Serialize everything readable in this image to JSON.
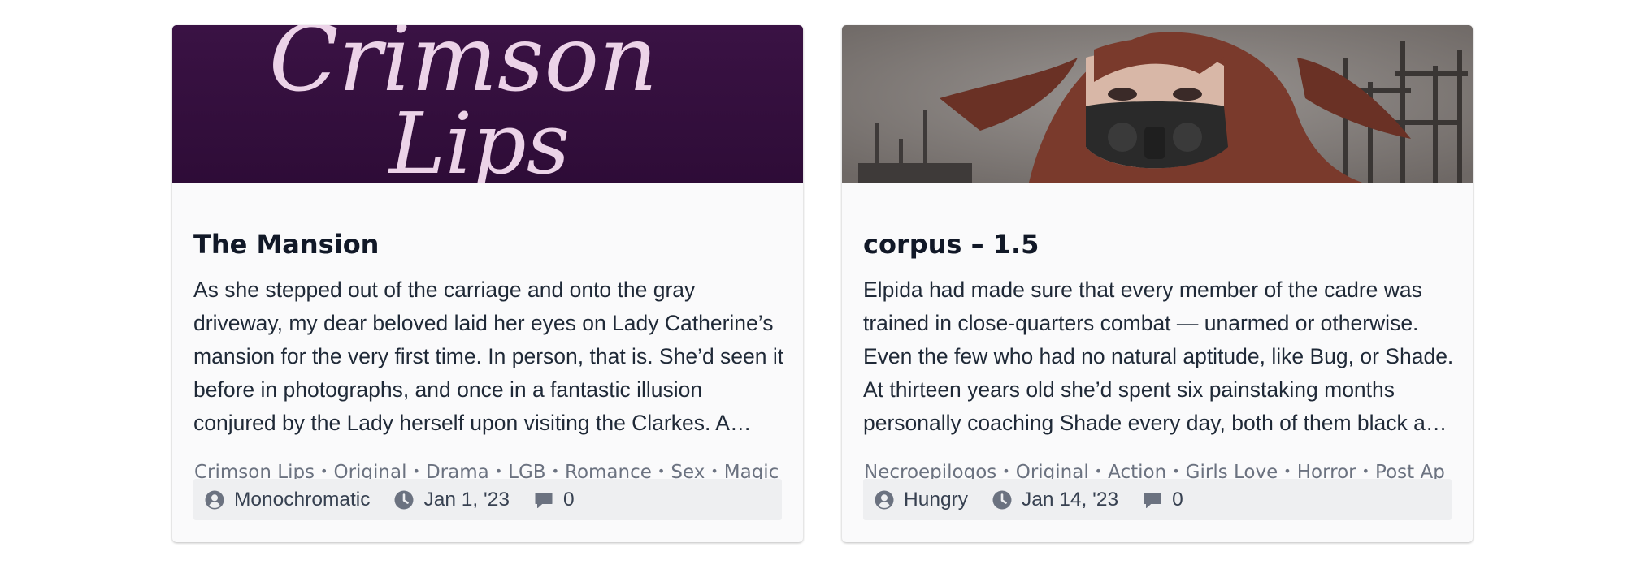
{
  "cards": [
    {
      "title": "The Mansion",
      "banner_text": [
        "Crimson",
        "Lips"
      ],
      "excerpt_lines": [
        "As she stepped out of the carriage and onto the gray",
        "driveway, my dear beloved laid her eyes on Lady Catherine’s",
        "mansion for the very first time. In person, that is. She’d seen it",
        "before in photographs, and once in a fantastic illusion",
        "conjured by the Lady herself upon visiting the Clarkes. A…"
      ],
      "tags": [
        "Crimson Lips",
        "Original",
        "Drama",
        "LGB",
        "Romance",
        "Sex",
        "Magic"
      ],
      "author": "Monochromatic",
      "date": "Jan 1, '23",
      "comments": "0",
      "colors": {
        "banner_bg": "#35103f",
        "banner_text": "#ecd3e8"
      }
    },
    {
      "title": "corpus – 1.5",
      "excerpt_lines": [
        "Elpida had made sure that every member of the cadre was",
        "trained in close-quarters combat — unarmed or otherwise.",
        "Even the few who had no natural aptitude, like Bug, or Shade.",
        "At thirteen years old she’d spent six painstaking months",
        "personally coaching Shade every day, both of them black an…"
      ],
      "tags": [
        "Necroepilogos",
        "Original",
        "Action",
        "Girls Love",
        "Horror",
        "Post Ap"
      ],
      "author": "Hungry",
      "date": "Jan 14, '23",
      "comments": "0",
      "colors": {
        "banner_bg": "#7d7774",
        "hair": "#7a3a2c",
        "mask": "#2a2a2a"
      }
    }
  ],
  "icons": {
    "author": "user-circle-icon",
    "date": "clock-icon",
    "comments": "chat-bubble-icon"
  },
  "colors": {
    "card_bg": "#fafafb",
    "meta_bg": "#eeeff1",
    "title": "#111827",
    "muted": "#6b7280"
  }
}
